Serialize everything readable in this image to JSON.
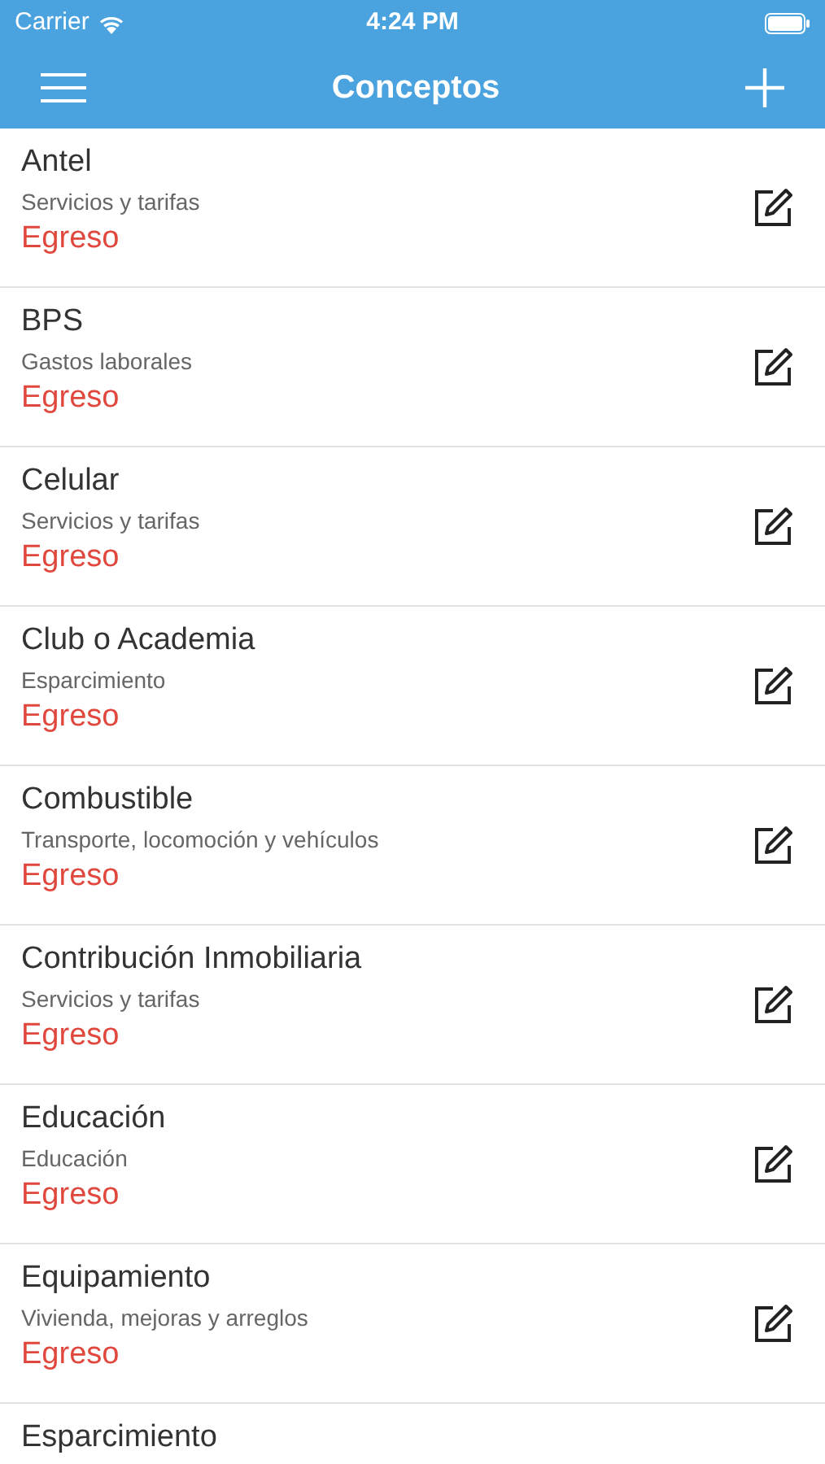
{
  "status_bar": {
    "carrier": "Carrier",
    "time": "4:24 PM"
  },
  "nav_bar": {
    "title": "Conceptos"
  },
  "items": [
    {
      "title": "Antel",
      "category": "Servicios y tarifas",
      "type": "Egreso"
    },
    {
      "title": "BPS",
      "category": "Gastos laborales",
      "type": "Egreso"
    },
    {
      "title": "Celular",
      "category": "Servicios y tarifas",
      "type": "Egreso"
    },
    {
      "title": "Club o Academia",
      "category": "Esparcimiento",
      "type": "Egreso"
    },
    {
      "title": "Combustible",
      "category": "Transporte, locomoción y vehículos",
      "type": "Egreso"
    },
    {
      "title": "Contribución Inmobiliaria",
      "category": "Servicios y tarifas",
      "type": "Egreso"
    },
    {
      "title": "Educación",
      "category": "Educación",
      "type": "Egreso"
    },
    {
      "title": "Equipamiento",
      "category": "Vivienda, mejoras y arreglos",
      "type": "Egreso"
    },
    {
      "title": "Esparcimiento"
    }
  ]
}
